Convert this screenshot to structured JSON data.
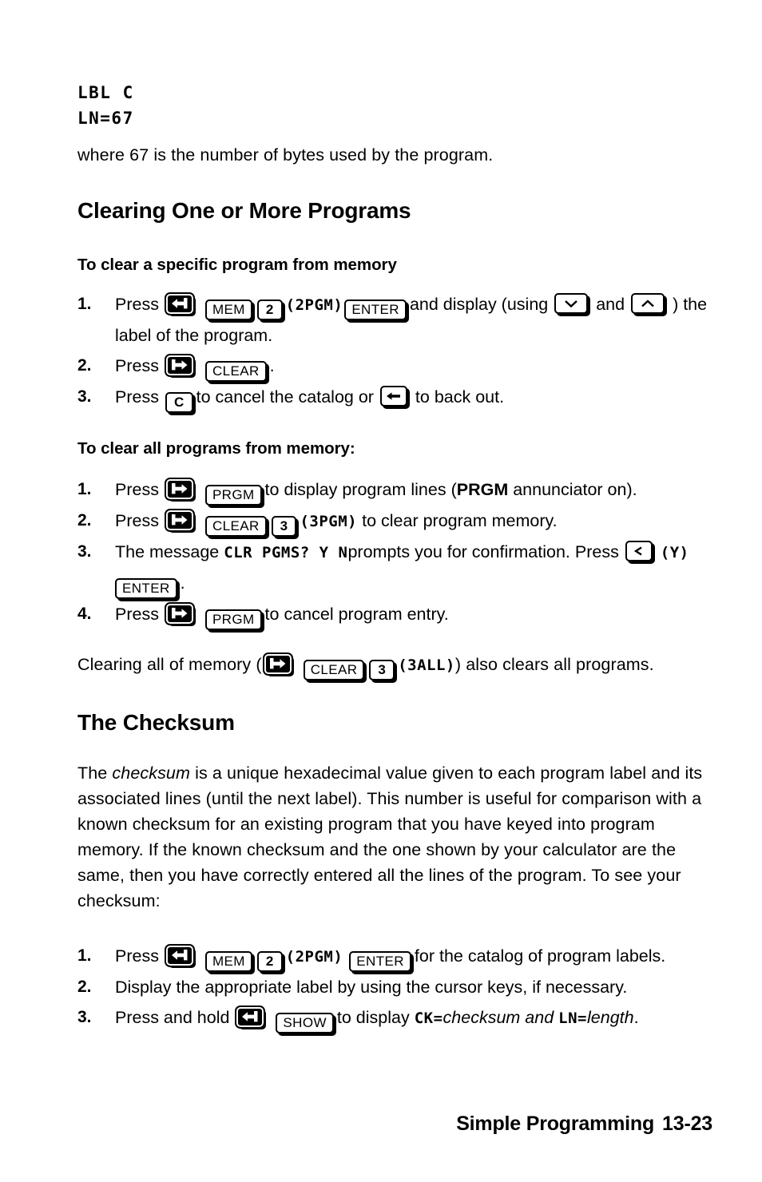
{
  "display_top": {
    "line1": "LBL C",
    "line2": "LN=67"
  },
  "intro_paragraph": "where 67 is the number of bytes used by the program.",
  "section_clearing": {
    "heading": "Clearing One or More Programs",
    "subhead_specific": "To clear a specific program from memory",
    "steps_specific": [
      {
        "num": "1.",
        "t1": "Press",
        "key_shift_left": "left-shift-key",
        "key_mem": "MEM",
        "key_2": "2",
        "paren_lcd_1": "(2PGM)",
        "key_enter": "ENTER",
        "t2": "and display (using",
        "key_down": "down-arrow-key",
        "t3": "and",
        "key_up": "up-arrow-key",
        "t4": ") the label of the program."
      },
      {
        "num": "2.",
        "t1": "Press",
        "key_shift_right": "right-shift-key",
        "key_clear": "CLEAR",
        "t2": "."
      },
      {
        "num": "3.",
        "t1": "Press",
        "key_c": "C",
        "t2": "to cancel the catalog or",
        "key_back": "backspace-key",
        "t3": "to back out."
      }
    ],
    "subhead_all": "To clear all programs from memory:",
    "steps_all": [
      {
        "num": "1.",
        "t1": "Press",
        "key_shift_right": "right-shift-key",
        "key_prgm": "PRGM",
        "t2": "to display program lines (",
        "annunciator": "PRGM",
        "t3": "annunciator on)."
      },
      {
        "num": "2.",
        "t1": "Press",
        "key_shift_right": "right-shift-key",
        "key_clear": "CLEAR",
        "key_3": "3",
        "paren_lcd": "(3PGM)",
        "t2": "to clear program memory."
      },
      {
        "num": "3.",
        "t1": "The message",
        "lcd_message": "CLR PGMS? Y N",
        "t2": "prompts you for confirmation. Press",
        "key_left": "left-arrow-key",
        "paren_lcd": "(Y)",
        "key_enter": "ENTER",
        "t3": "."
      },
      {
        "num": "4.",
        "t1": "Press",
        "key_shift_right": "right-shift-key",
        "key_prgm": "PRGM",
        "t2": "to cancel program entry."
      }
    ],
    "closing": {
      "t1": "Clearing all of memory (",
      "key_shift_right": "right-shift-key",
      "key_clear": "CLEAR",
      "key_3": "3",
      "paren_lcd": "(3ALL)",
      "t2": ") also clears all programs."
    }
  },
  "section_checksum": {
    "heading": "The Checksum",
    "paragraph": {
      "p1": "The ",
      "ital1": "checksum",
      "p2": " is a unique hexadecimal value given to each program label and its associated lines (until the next label). This number is useful for comparison with a known checksum for an existing program that you have keyed into program memory. If the known checksum and the one shown by your calculator are the same, then you have correctly entered all the lines of the program. To see your checksum:"
    },
    "steps": [
      {
        "num": "1.",
        "t1": "Press",
        "key_shift_left": "left-shift-key",
        "key_mem": "MEM",
        "key_2": "2",
        "paren_lcd": "(2PGM)",
        "key_enter": "ENTER",
        "t2": "for the catalog of program labels."
      },
      {
        "num": "2.",
        "t1": "Display the appropriate label by using the cursor keys, if necessary."
      },
      {
        "num": "3.",
        "t1": "Press and hold",
        "key_shift_left": "left-shift-key",
        "key_show": "SHOW",
        "t2": "to display",
        "lcd_ck": "CK=",
        "ital_checksum": "checksum and",
        "lcd_ln": "LN=",
        "ital_length": "length",
        "t3": "."
      }
    ]
  },
  "footer": {
    "title": "Simple Programming",
    "page": "13-23"
  }
}
